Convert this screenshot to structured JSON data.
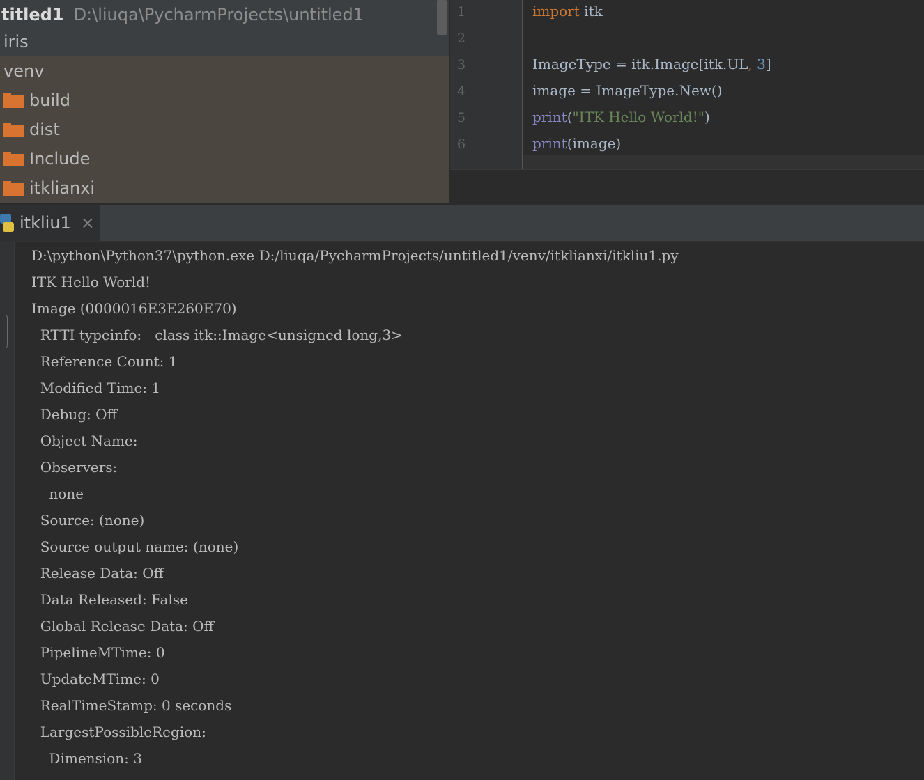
{
  "project": {
    "root_name": "titled1",
    "root_path": "D:\\liuqa\\PycharmProjects\\untitled1",
    "items": [
      {
        "label": "iris",
        "type": "module"
      },
      {
        "label": "venv",
        "type": "module"
      },
      {
        "label": "build",
        "type": "folder"
      },
      {
        "label": "dist",
        "type": "folder"
      },
      {
        "label": "Include",
        "type": "folder"
      },
      {
        "label": "itklianxi",
        "type": "folder"
      }
    ],
    "folder_color": "#d97330"
  },
  "editor": {
    "line_numbers": [
      "1",
      "2",
      "3",
      "4",
      "5",
      "6"
    ],
    "code": {
      "l1_kw": "import",
      "l1_rest": " itk",
      "l3_a": "ImageType = itk.Image[itk.UL",
      "l3_comma": ",",
      "l3_sp": " ",
      "l3_num": "3",
      "l3_end": "]",
      "l4": "image = ImageType.New()",
      "l5_fn": "print",
      "l5_open": "(",
      "l5_str": "\"ITK Hello World!\"",
      "l5_close": ")",
      "l6_fn": "print",
      "l6_rest": "(image)"
    }
  },
  "run": {
    "tab_label": "itkliu1",
    "close_glyph": "×",
    "output": [
      "D:\\python\\Python37\\python.exe D:/liuqa/PycharmProjects/untitled1/venv/itklianxi/itkliu1.py",
      "ITK Hello World!",
      "Image (0000016E3E260E70)",
      "  RTTI typeinfo:   class itk::Image<unsigned long,3>",
      "  Reference Count: 1",
      "  Modified Time: 1",
      "  Debug: Off",
      "  Object Name: ",
      "  Observers: ",
      "    none",
      "  Source: (none)",
      "  Source output name: (none)",
      "  Release Data: Off",
      "  Data Released: False",
      "  Global Release Data: Off",
      "  PipelineMTime: 0",
      "  UpdateMTime: 0",
      "  RealTimeStamp: 0 seconds",
      "  LargestPossibleRegion: ",
      "    Dimension: 3"
    ]
  },
  "colors": {
    "background": "#2b2b2b",
    "panel": "#3c3f41",
    "keyword": "#cc7832",
    "number": "#6897bb",
    "string": "#6a8759",
    "builtin": "#8888c6"
  }
}
